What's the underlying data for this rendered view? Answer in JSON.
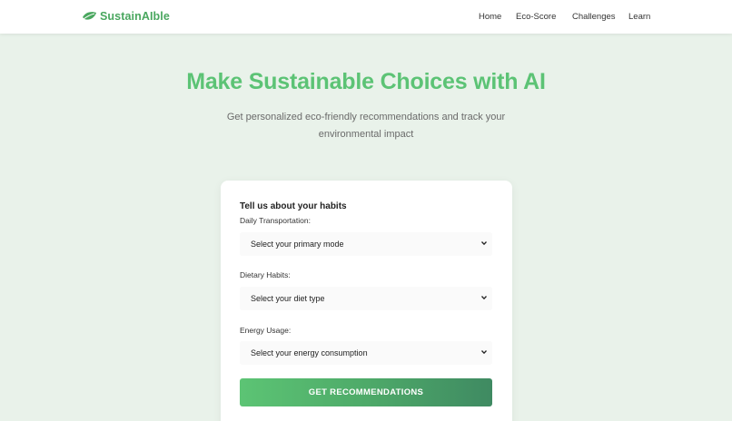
{
  "brand": {
    "name": "SustainAIble",
    "icon": "leaf-icon",
    "color": "#4aa75f"
  },
  "nav": {
    "items": [
      {
        "label": "Home"
      },
      {
        "label": "Eco-Score"
      },
      {
        "label": "Challenges"
      },
      {
        "label": "Learn"
      }
    ]
  },
  "hero": {
    "title": "Make Sustainable Choices with AI",
    "subtitle": "Get personalized eco-friendly recommendations and track your environmental impact",
    "title_color": "#5cc375"
  },
  "form": {
    "title": "Tell us about your habits",
    "fields": [
      {
        "label": "Daily Transportation:",
        "selected": "Select your primary mode",
        "icon": "chevron-down-icon"
      },
      {
        "label": "Dietary Habits:",
        "selected": "Select your diet type",
        "icon": "chevron-down-icon"
      },
      {
        "label": "Energy Usage:",
        "selected": "Select your energy consumption",
        "icon": "chevron-down-icon"
      }
    ],
    "submit_label": "GET RECOMMENDATIONS"
  },
  "colors": {
    "background": "#e9f2ea",
    "accent": "#5cc375",
    "button_end": "#3f8a62"
  }
}
